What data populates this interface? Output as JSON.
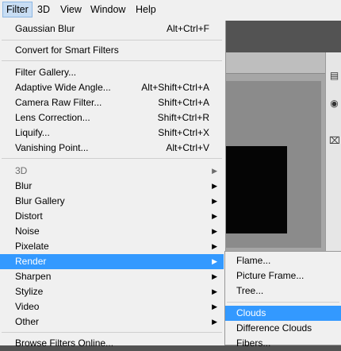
{
  "menubar": {
    "items": [
      {
        "label": "Filter"
      },
      {
        "label": "3D"
      },
      {
        "label": "View"
      },
      {
        "label": "Window"
      },
      {
        "label": "Help"
      }
    ]
  },
  "filter_menu": {
    "items": [
      {
        "label": "Gaussian Blur",
        "shortcut": "Alt+Ctrl+F"
      },
      {
        "label": "Convert for Smart Filters"
      },
      {
        "label": "Filter Gallery..."
      },
      {
        "label": "Adaptive Wide Angle...",
        "shortcut": "Alt+Shift+Ctrl+A"
      },
      {
        "label": "Camera Raw Filter...",
        "shortcut": "Shift+Ctrl+A"
      },
      {
        "label": "Lens Correction...",
        "shortcut": "Shift+Ctrl+R"
      },
      {
        "label": "Liquify...",
        "shortcut": "Shift+Ctrl+X"
      },
      {
        "label": "Vanishing Point...",
        "shortcut": "Alt+Ctrl+V"
      },
      {
        "label": "3D",
        "disabled": true
      },
      {
        "label": "Blur"
      },
      {
        "label": "Blur Gallery"
      },
      {
        "label": "Distort"
      },
      {
        "label": "Noise"
      },
      {
        "label": "Pixelate"
      },
      {
        "label": "Render",
        "highlighted": true
      },
      {
        "label": "Sharpen"
      },
      {
        "label": "Stylize"
      },
      {
        "label": "Video"
      },
      {
        "label": "Other"
      },
      {
        "label": "Browse Filters Online..."
      }
    ]
  },
  "render_submenu": {
    "items": [
      {
        "label": "Flame..."
      },
      {
        "label": "Picture Frame..."
      },
      {
        "label": "Tree..."
      },
      {
        "label": "Clouds",
        "highlighted": true
      },
      {
        "label": "Difference Clouds"
      },
      {
        "label": "Fibers..."
      }
    ]
  },
  "icons": {
    "submenu_arrow": "▶",
    "panel_icons": [
      "panel-icon-1",
      "panel-icon-2",
      "panel-icon-3"
    ]
  },
  "colors": {
    "highlight": "#3399ff",
    "menu_bg": "#f0f0f0"
  }
}
